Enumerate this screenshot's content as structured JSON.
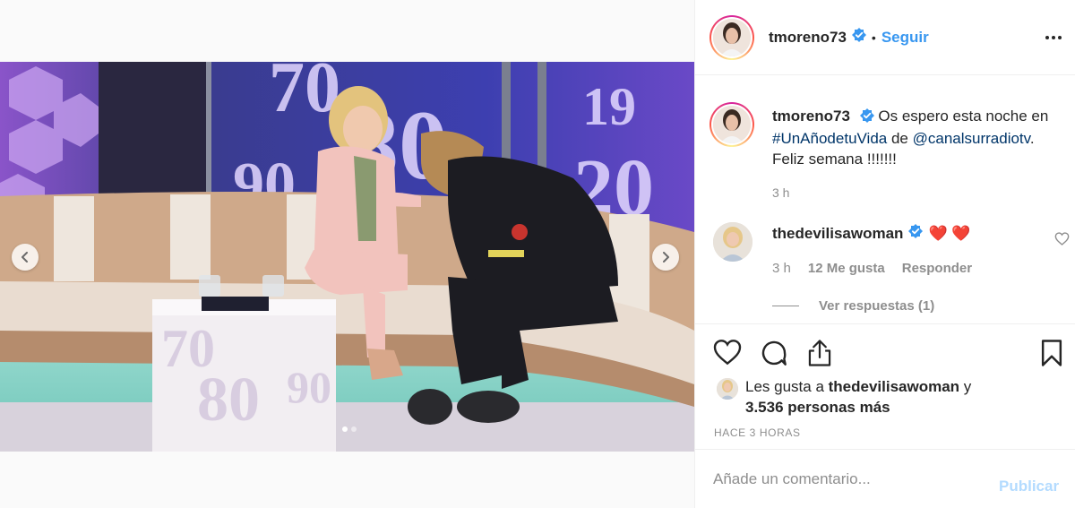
{
  "post": {
    "owner": "tmoreno73",
    "follow_label": "Seguir",
    "separator": "•",
    "carousel": {
      "total": 2,
      "current": 1
    }
  },
  "caption": {
    "user": "tmoreno73",
    "text_part1": "Os espero esta noche en ",
    "hashtag": "#UnAñodetuVida",
    "text_part2": " de ",
    "mention": "@canalsurradiotv",
    "text_part3": ". Feliz semana !!!!!!!",
    "time": "3 h"
  },
  "comment": {
    "user": "thedevilisawoman",
    "text": "❤️ ❤️",
    "time": "3 h",
    "likes": "12 Me gusta",
    "reply_label": "Responder",
    "view_replies": "Ver respuestas (1)"
  },
  "likes": {
    "prefix": "Les gusta a ",
    "user": "thedevilisawoman",
    "conj": " y",
    "count": "3.536 personas más"
  },
  "timestamp": "HACE 3 HORAS",
  "comment_box": {
    "placeholder": "Añade un comentario...",
    "publish_label": "Publicar"
  },
  "icons": {
    "verified": "verified-badge-icon",
    "more": "more-options-icon",
    "like": "heart-icon",
    "comment": "comment-icon",
    "share": "share-icon",
    "save": "bookmark-icon",
    "prev": "chevron-left-icon",
    "next": "chevron-right-icon"
  },
  "colors": {
    "link": "#003569",
    "accent": "#3897f0",
    "muted": "#8e8e8e",
    "publish_disabled": "#b3dbff",
    "verified": "#3897f0"
  }
}
